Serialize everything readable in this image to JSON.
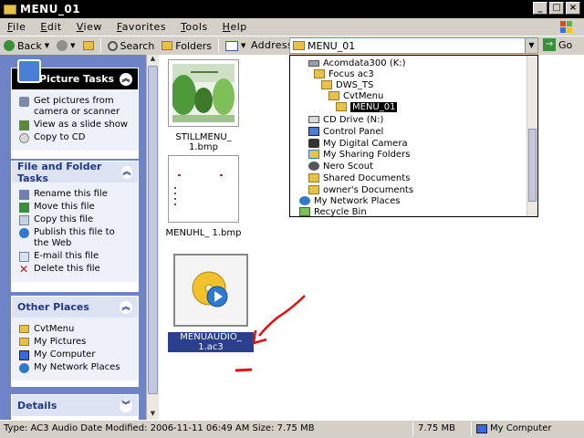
{
  "window": {
    "title": "MENU_01"
  },
  "menubar": [
    "File",
    "Edit",
    "View",
    "Favorites",
    "Tools",
    "Help"
  ],
  "toolbar": {
    "back": "Back",
    "search": "Search",
    "folders": "Folders",
    "address_label": "Address",
    "address_value": "MENU_01",
    "go": "Go"
  },
  "sidebar": {
    "picture_tasks": {
      "title": "Picture Tasks",
      "items": [
        "Get pictures from camera or scanner",
        "View as a slide show",
        "Copy to CD"
      ]
    },
    "file_tasks": {
      "title": "File and Folder Tasks",
      "items": [
        "Rename this file",
        "Move this file",
        "Copy this file",
        "Publish this file to the Web",
        "E-mail this file",
        "Delete this file"
      ]
    },
    "other_places": {
      "title": "Other Places",
      "items": [
        "CvtMenu",
        "My Pictures",
        "My Computer",
        "My Network Places"
      ]
    },
    "details": {
      "title": "Details"
    }
  },
  "files": [
    {
      "name": "STILLMENU_ 1.bmp"
    },
    {
      "name": "MENUHL_ 1.bmp"
    },
    {
      "name": "MENUAUDIO_ 1.ac3"
    }
  ],
  "address_dropdown": [
    {
      "label": "Acomdata300 (K:)",
      "icon": "drive-icon"
    },
    {
      "label": "Focus ac3",
      "icon": "folder-icon"
    },
    {
      "label": "DWS_TS",
      "icon": "folder-icon"
    },
    {
      "label": "CvtMenu",
      "icon": "folder-icon"
    },
    {
      "label": "MENU_01",
      "icon": "folder-open-icon",
      "selected": true
    },
    {
      "label": "CD Drive (N:)",
      "icon": "cd-drive-icon"
    },
    {
      "label": "Control Panel",
      "icon": "control-panel-icon"
    },
    {
      "label": "My Digital Camera",
      "icon": "camera-icon"
    },
    {
      "label": "My Sharing Folders",
      "icon": "sharing-folder-icon"
    },
    {
      "label": "Nero Scout",
      "icon": "nero-icon"
    },
    {
      "label": "Shared Documents",
      "icon": "folder-icon"
    },
    {
      "label": "owner's Documents",
      "icon": "folder-icon"
    },
    {
      "label": "My Network Places",
      "icon": "network-icon"
    },
    {
      "label": "Recycle Bin",
      "icon": "recycle-bin-icon"
    }
  ],
  "statusbar": {
    "info": "Type: AC3 Audio Date Modified: 2006-11-11 06:49 AM Size: 7.75 MB",
    "size": "7.75 MB",
    "location": "My Computer"
  },
  "colors": {
    "sidebar_bg": "#6d83c6",
    "selection": "#2a3f8e",
    "annotation": "#e01010",
    "toolbar_bg": "#d4d0c8"
  }
}
